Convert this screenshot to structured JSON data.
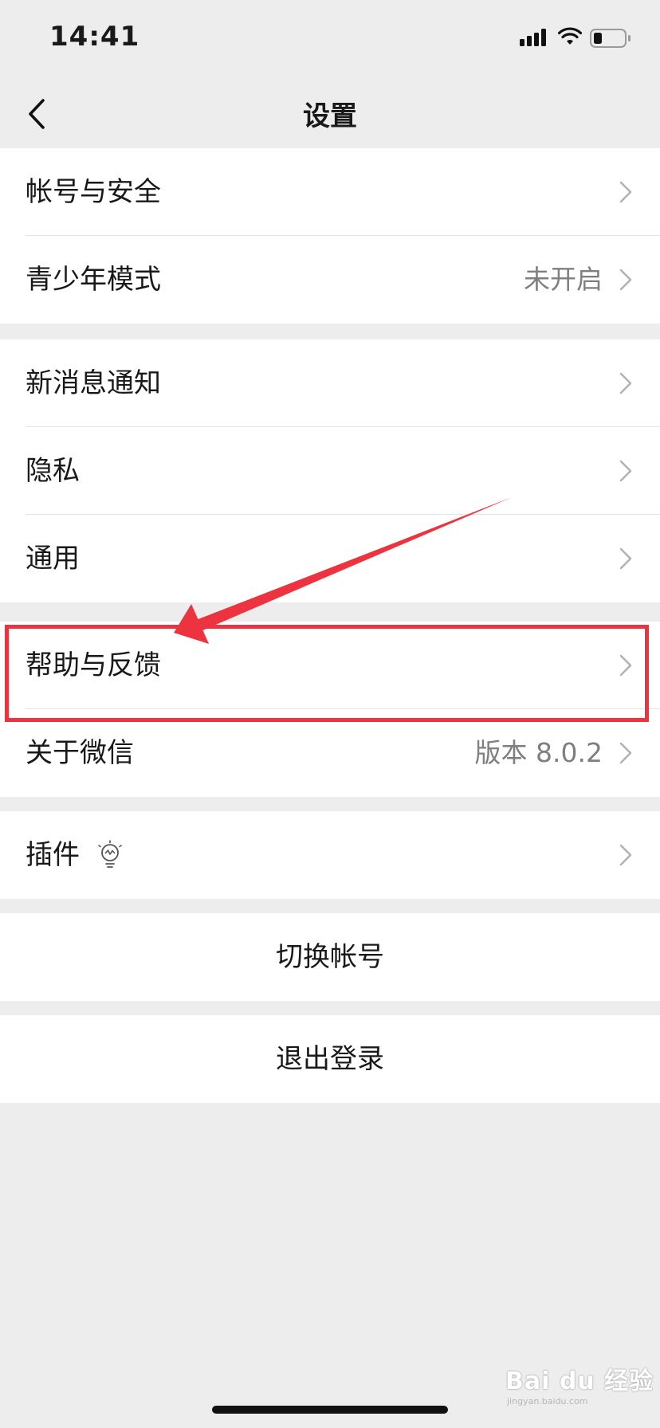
{
  "status_bar": {
    "time": "14:41",
    "icons": [
      "signal-icon",
      "wifi-icon",
      "battery-icon"
    ]
  },
  "nav": {
    "title": "设置",
    "back_icon": "back-chevron-icon"
  },
  "groups": [
    {
      "items": [
        {
          "label": "帐号与安全",
          "value": ""
        },
        {
          "label": "青少年模式",
          "value": "未开启"
        }
      ]
    },
    {
      "items": [
        {
          "label": "新消息通知",
          "value": ""
        },
        {
          "label": "隐私",
          "value": ""
        },
        {
          "label": "通用",
          "value": ""
        }
      ]
    },
    {
      "items": [
        {
          "label": "帮助与反馈",
          "value": ""
        },
        {
          "label": "关于微信",
          "value": "版本 8.0.2"
        }
      ]
    },
    {
      "items": [
        {
          "label": "插件",
          "value": "",
          "icon": "lightbulb-icon"
        }
      ]
    }
  ],
  "actions": {
    "switch_account": "切换帐号",
    "logout": "退出登录"
  },
  "annotation": {
    "highlight_color": "#ee3340",
    "highlighted_item": "帮助与反馈"
  },
  "watermark": {
    "text": "Bai du 经验",
    "sub": "jingyan.baidu.com"
  },
  "colors": {
    "background": "#ededed",
    "cell": "#ffffff",
    "text": "#191919",
    "secondary_text": "#7f7f7f",
    "chevron": "#b2b2b2",
    "annotation": "#ee3340"
  }
}
